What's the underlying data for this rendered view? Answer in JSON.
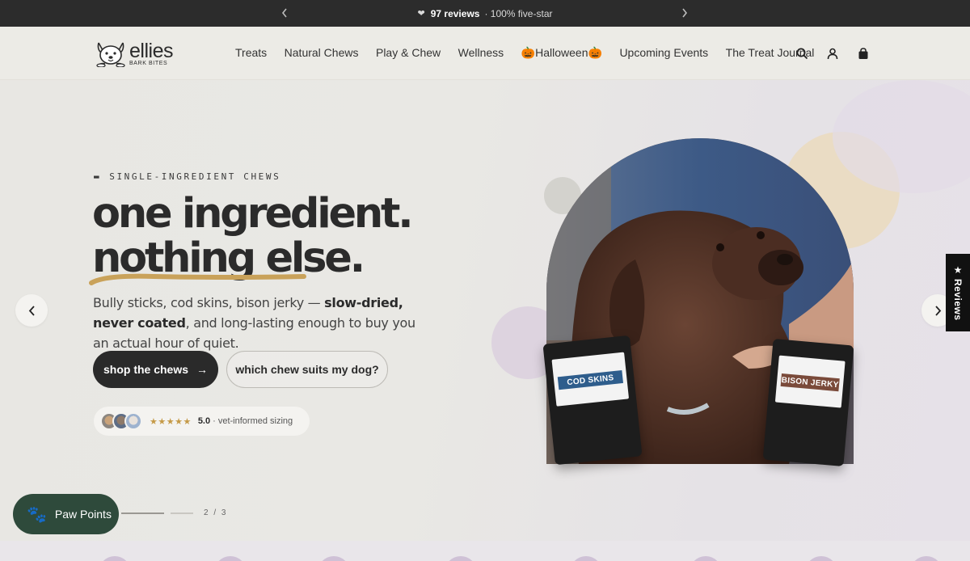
{
  "announcement": {
    "reviews_bold": "97 reviews",
    "reviews_rest": "· 100% five-star",
    "prev_icon": "chevron-left-icon",
    "next_icon": "chevron-right-icon"
  },
  "header": {
    "logo_word": "ellies",
    "logo_sub": "BARK BITES",
    "nav": [
      "Treats",
      "Natural Chews",
      "Play & Chew",
      "Wellness",
      "🎃Halloween🎃",
      "Upcoming Events",
      "The Treat Journal"
    ],
    "icons": [
      "search-icon",
      "account-icon",
      "cart-bag-icon"
    ]
  },
  "hero": {
    "eyebrow": "SINGLE-INGREDIENT CHEWS",
    "headline_1": "one ingredient.",
    "headline_2": "nothing else.",
    "sub_1": "Bully sticks, cod skins, bison jerky — ",
    "sub_bold": "slow-dried, never coated",
    "sub_2": ", and long-lasting enough to buy you an actual hour of quiet.",
    "primary_cta": "shop the chews",
    "primary_cta_arrow": "→",
    "secondary_cta": "which chew suits my dog?",
    "proof_stars": "★★★★★",
    "proof_score": "5.0",
    "proof_text": "· vet-informed sizing",
    "pouch_left": "COD SKINS",
    "pouch_right": "BISON JERKY",
    "pager_count": "2 / 3"
  },
  "widgets": {
    "paw_points": "Paw Points",
    "reviews_tab": "Reviews"
  },
  "colors": {
    "announce_bg": "#2c2c2c",
    "primary_button": "#2a2a2a",
    "paw_button": "#2e4a3b",
    "swoosh": "#c9a25a",
    "stars": "#c59a47"
  }
}
